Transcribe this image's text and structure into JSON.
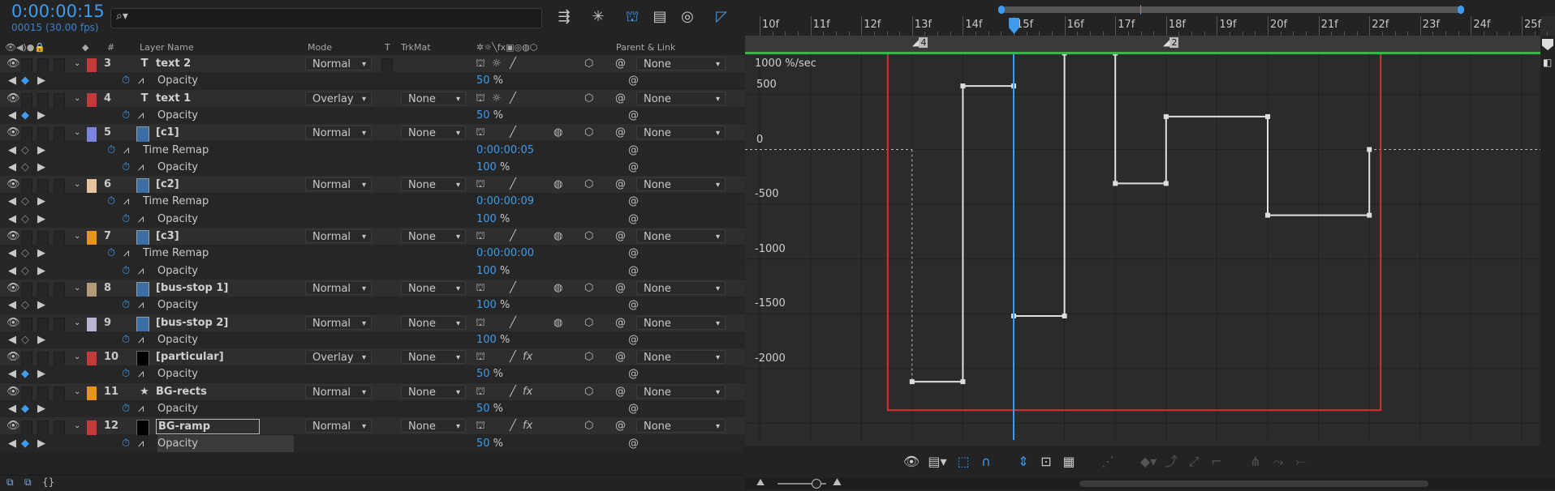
{
  "comp": {
    "timecode": "0:00:00:15",
    "frames": "00015 (30.00 fps)"
  },
  "columns": {
    "hash": "#",
    "layer_name": "Layer Name",
    "mode": "Mode",
    "t": "T",
    "trkmat": "TrkMat",
    "parent": "Parent & Link"
  },
  "rows": [
    {
      "kind": "layer",
      "num": "3",
      "type": "T",
      "name": "text 2",
      "color": "#c23a3a",
      "mode": "Normal",
      "trk": "",
      "parent": "None",
      "fx": false,
      "thumb": null
    },
    {
      "kind": "prop",
      "name": "Opacity",
      "value": "50",
      "unit": " %",
      "keyed": true
    },
    {
      "kind": "layer",
      "num": "4",
      "type": "T",
      "name": "text 1",
      "color": "#c23a3a",
      "mode": "Overlay",
      "trk": "None",
      "parent": "None",
      "fx": false,
      "thumb": null
    },
    {
      "kind": "prop",
      "name": "Opacity",
      "value": "50",
      "unit": " %",
      "keyed": true
    },
    {
      "kind": "layer",
      "num": "5",
      "type": "thumb",
      "name": "[c1]",
      "color": "#7b85e0",
      "mode": "Normal",
      "trk": "None",
      "parent": "None",
      "fx": false,
      "thumb": "comp"
    },
    {
      "kind": "prop",
      "name": "Time Remap",
      "value": "0:00:00:05",
      "unit": "",
      "keyed": false,
      "indent": true
    },
    {
      "kind": "prop",
      "name": "Opacity",
      "value": "100",
      "unit": " %",
      "keyed": false
    },
    {
      "kind": "layer",
      "num": "6",
      "type": "thumb",
      "name": "[c2]",
      "color": "#e8c3a0",
      "mode": "Normal",
      "trk": "None",
      "parent": "None",
      "fx": false,
      "thumb": "comp"
    },
    {
      "kind": "prop",
      "name": "Time Remap",
      "value": "0:00:00:09",
      "unit": "",
      "keyed": false,
      "indent": true
    },
    {
      "kind": "prop",
      "name": "Opacity",
      "value": "100",
      "unit": " %",
      "keyed": false
    },
    {
      "kind": "layer",
      "num": "7",
      "type": "thumb",
      "name": "[c3]",
      "color": "#e8941a",
      "mode": "Normal",
      "trk": "None",
      "parent": "None",
      "fx": false,
      "thumb": "comp"
    },
    {
      "kind": "prop",
      "name": "Time Remap",
      "value": "0:00:00:00",
      "unit": "",
      "keyed": false,
      "indent": true
    },
    {
      "kind": "prop",
      "name": "Opacity",
      "value": "100",
      "unit": " %",
      "keyed": false
    },
    {
      "kind": "layer",
      "num": "8",
      "type": "thumb",
      "name": "[bus-stop 1]",
      "color": "#b39b7a",
      "mode": "Normal",
      "trk": "None",
      "parent": "None",
      "fx": false,
      "thumb": "comp"
    },
    {
      "kind": "prop",
      "name": "Opacity",
      "value": "100",
      "unit": " %",
      "keyed": false
    },
    {
      "kind": "layer",
      "num": "9",
      "type": "thumb",
      "name": "[bus-stop 2]",
      "color": "#b7b4d8",
      "mode": "Normal",
      "trk": "None",
      "parent": "None",
      "fx": false,
      "thumb": "comp"
    },
    {
      "kind": "prop",
      "name": "Opacity",
      "value": "100",
      "unit": " %",
      "keyed": false
    },
    {
      "kind": "layer",
      "num": "10",
      "type": "thumb",
      "name": "[particular]",
      "color": "#c23a3a",
      "mode": "Overlay",
      "trk": "None",
      "parent": "None",
      "fx": true,
      "thumb": "black"
    },
    {
      "kind": "prop",
      "name": "Opacity",
      "value": "50",
      "unit": " %",
      "keyed": true
    },
    {
      "kind": "layer",
      "num": "11",
      "type": "star",
      "name": "BG-rects",
      "color": "#e8941a",
      "mode": "Normal",
      "trk": "None",
      "parent": "None",
      "fx": true,
      "thumb": null
    },
    {
      "kind": "prop",
      "name": "Opacity",
      "value": "50",
      "unit": " %",
      "keyed": true
    },
    {
      "kind": "layer",
      "num": "12",
      "type": "thumb",
      "name": "BG-ramp",
      "color": "#c23a3a",
      "mode": "Normal",
      "trk": "None",
      "parent": "None",
      "fx": true,
      "thumb": "black",
      "selected": true
    },
    {
      "kind": "prop",
      "name": "Opacity",
      "value": "50",
      "unit": " %",
      "keyed": true,
      "selected": true
    }
  ],
  "timeline": {
    "ticks": [
      "10f",
      "11f",
      "12f",
      "13f",
      "14f",
      "15f",
      "16f",
      "17f",
      "18f",
      "19f",
      "20f",
      "21f",
      "22f",
      "23f",
      "24f",
      "25f"
    ],
    "markers": [
      "4",
      "2"
    ],
    "unit_label": "1000 %/sec",
    "y_labels": [
      "500",
      "0",
      "-500",
      "-1000",
      "-1500",
      "-2000"
    ]
  },
  "graph_data": {
    "type": "line",
    "title": "",
    "x_unit": "frame",
    "y_unit": "%/sec",
    "current_frame": 15,
    "ylim": [
      -2350,
      1200
    ],
    "points": [
      [
        13,
        -2120
      ],
      [
        14,
        -2120
      ],
      [
        14,
        580
      ],
      [
        15,
        580
      ],
      [
        15,
        -1520
      ],
      [
        16,
        -1520
      ],
      [
        16,
        880
      ],
      [
        17,
        880
      ],
      [
        17,
        -310
      ],
      [
        18,
        -310
      ],
      [
        18,
        300
      ],
      [
        20,
        300
      ],
      [
        20,
        -600
      ],
      [
        22,
        -600
      ],
      [
        22,
        0
      ]
    ]
  },
  "colors": {
    "accent": "#3d9cf0",
    "selection_box": "#d83030",
    "work_area": "#33b84a"
  }
}
